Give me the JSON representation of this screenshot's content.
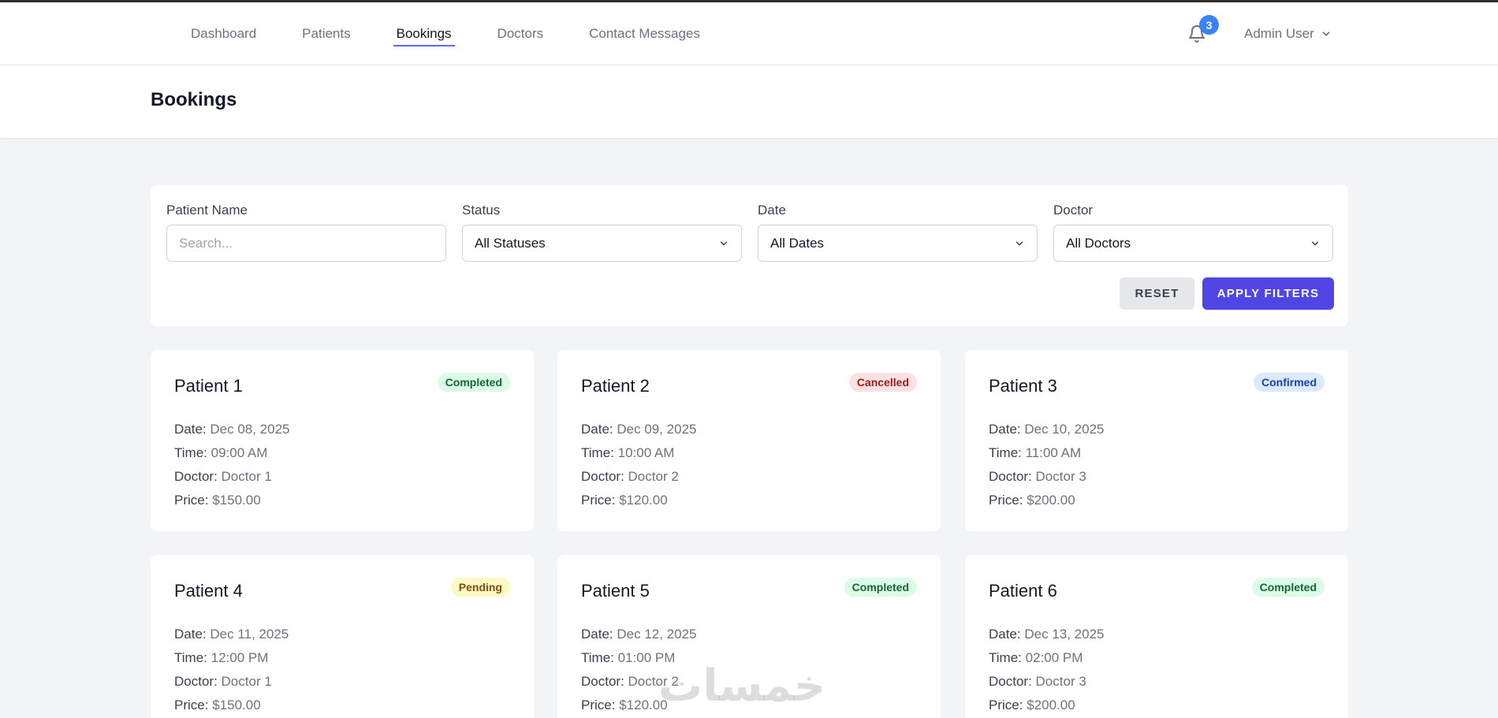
{
  "nav": {
    "links": [
      {
        "label": "Dashboard",
        "active": false
      },
      {
        "label": "Patients",
        "active": false
      },
      {
        "label": "Bookings",
        "active": true
      },
      {
        "label": "Doctors",
        "active": false
      },
      {
        "label": "Contact Messages",
        "active": false
      }
    ],
    "notification_count": "3",
    "user_name": "Admin User"
  },
  "page": {
    "title": "Bookings"
  },
  "filters": {
    "patient_name_label": "Patient Name",
    "patient_name_placeholder": "Search...",
    "status_label": "Status",
    "status_value": "All Statuses",
    "date_label": "Date",
    "date_value": "All Dates",
    "doctor_label": "Doctor",
    "doctor_value": "All Doctors",
    "reset_label": "RESET",
    "apply_label": "APPLY FILTERS"
  },
  "labels": {
    "date": "Date:",
    "time": "Time:",
    "doctor": "Doctor:",
    "price": "Price:"
  },
  "bookings": [
    {
      "patient": "Patient 1",
      "status": "Completed",
      "date": "Dec 08, 2025",
      "time": "09:00 AM",
      "doctor": "Doctor 1",
      "price": "$150.00"
    },
    {
      "patient": "Patient 2",
      "status": "Cancelled",
      "date": "Dec 09, 2025",
      "time": "10:00 AM",
      "doctor": "Doctor 2",
      "price": "$120.00"
    },
    {
      "patient": "Patient 3",
      "status": "Confirmed",
      "date": "Dec 10, 2025",
      "time": "11:00 AM",
      "doctor": "Doctor 3",
      "price": "$200.00"
    },
    {
      "patient": "Patient 4",
      "status": "Pending",
      "date": "Dec 11, 2025",
      "time": "12:00 PM",
      "doctor": "Doctor 1",
      "price": "$150.00"
    },
    {
      "patient": "Patient 5",
      "status": "Completed",
      "date": "Dec 12, 2025",
      "time": "01:00 PM",
      "doctor": "Doctor 2",
      "price": "$120.00"
    },
    {
      "patient": "Patient 6",
      "status": "Completed",
      "date": "Dec 13, 2025",
      "time": "02:00 PM",
      "doctor": "Doctor 3",
      "price": "$200.00"
    }
  ],
  "watermark": "خمسات",
  "colors": {
    "accent": "#4f46e5",
    "badge": "#3b82f6",
    "nav_underline": "#6366f1"
  }
}
